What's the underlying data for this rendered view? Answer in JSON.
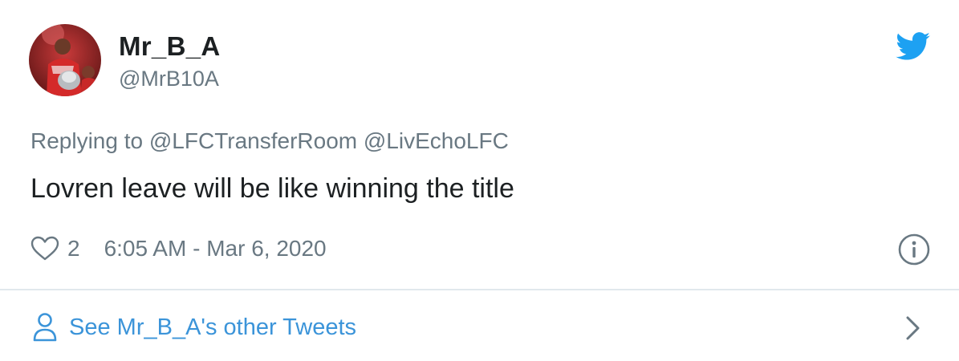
{
  "author": {
    "display_name": "Mr_B_A",
    "handle": "@MrB10A"
  },
  "reply": {
    "prefix": "Replying to",
    "mentions": [
      "@LFCTransferRoom",
      "@LivEchoLFC"
    ]
  },
  "tweet": {
    "text": "Lovren leave will be like winning the title"
  },
  "meta": {
    "like_count": "2",
    "timestamp": "6:05 AM - Mar 6, 2020"
  },
  "footer": {
    "see_more_label": "See Mr_B_A's other Tweets"
  },
  "icons": {
    "brand": "twitter-bird-icon",
    "like": "heart-icon",
    "info": "info-icon",
    "profile": "person-icon",
    "chevron": "chevron-right-icon"
  },
  "colors": {
    "twitter_blue": "#1da1f2",
    "link_blue": "#3b94d9",
    "secondary_text": "#697882",
    "primary_text": "#1c2022",
    "divider": "#e1e8ed"
  }
}
